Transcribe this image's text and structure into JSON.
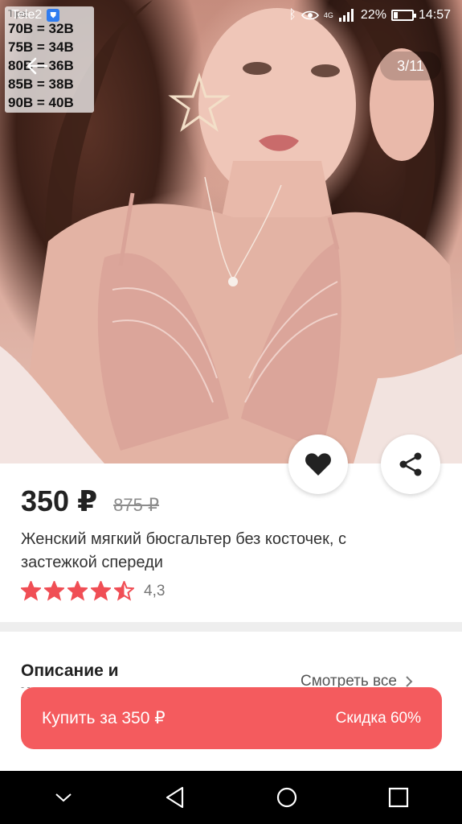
{
  "status_bar": {
    "carrier": "Tele2",
    "battery_percent": "22%",
    "battery_level": 0.22,
    "time": "14:57",
    "network_label": "4G"
  },
  "gallery": {
    "counter": "3/11",
    "size_chart": {
      "tips_label": "Tips:",
      "rows": [
        "70B = 32B",
        "75B = 34B",
        "80B = 36B",
        "85B = 38B",
        "90B = 40B"
      ]
    }
  },
  "product": {
    "price": "350 ₽",
    "old_price": "875 ₽",
    "title": "Женский мягкий бюсгальтер без косточек, с застежкой спереди",
    "rating_value": "4,3",
    "rating_stars": 4.3
  },
  "description": {
    "title": "Описание и характеристики",
    "see_all": "Смотреть все"
  },
  "buy": {
    "label": "Купить за 350 ₽",
    "discount": "Скидка 60%"
  },
  "colors": {
    "accent": "#f45b5e",
    "star": "#f04e55"
  }
}
